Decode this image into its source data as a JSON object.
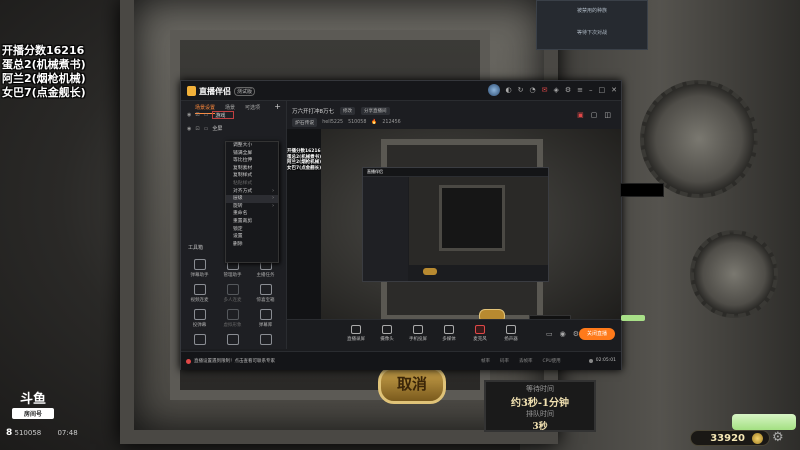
{
  "overlay_text": {
    "line1": "开播分数16216",
    "line2": "蛋总2(机械煮书)",
    "line3": "阿兰2(烟枪机械)",
    "line4": "女巴7(点金舰长)"
  },
  "top_right_menu": {
    "item1": "被禁用的种族",
    "item2": "等待下次对战"
  },
  "game": {
    "cancel_label": "取消",
    "wait_title": "等待时间",
    "wait_value": "约3秒-1分钟",
    "queue_title": "排队时间",
    "queue_value": "3秒",
    "gold": "33920",
    "logo": "斗鱼",
    "room_label": "房间号",
    "viewers": "8",
    "room_number": "510058",
    "time": "07:48"
  },
  "app": {
    "name": "直播伴侣",
    "badge": "测试版",
    "tabs": [
      "场景设置",
      "场景",
      "可选项"
    ],
    "add_label": "+",
    "scene_main": "游戏",
    "scene_label": "全屏",
    "context_menu": [
      {
        "label": "调整大小",
        "arrow": "",
        "state": "normal"
      },
      {
        "label": "铺满全屏",
        "arrow": "",
        "state": "normal"
      },
      {
        "label": "等比拉伸",
        "arrow": "",
        "state": "normal"
      },
      {
        "label": "复制素材",
        "arrow": "",
        "state": "normal"
      },
      {
        "label": "复制样式",
        "arrow": "",
        "state": "normal"
      },
      {
        "label": "粘贴样式",
        "arrow": "",
        "state": "dim"
      },
      {
        "label": "对齐方式",
        "arrow": "›",
        "state": "normal"
      },
      {
        "label": "层级",
        "arrow": "›",
        "state": "sel"
      },
      {
        "label": "旋转",
        "arrow": "›",
        "state": "normal"
      },
      {
        "label": "重命名",
        "arrow": "",
        "state": "normal"
      },
      {
        "label": "重置裁剪",
        "arrow": "",
        "state": "normal"
      },
      {
        "label": "锁定",
        "arrow": "",
        "state": "normal"
      },
      {
        "label": "设置",
        "arrow": "",
        "state": "normal"
      },
      {
        "label": "删除",
        "arrow": "",
        "state": "normal"
      }
    ],
    "tools_label": "工具箱",
    "tools": [
      {
        "label": "弹幕助手",
        "state": "normal"
      },
      {
        "label": "管理助手",
        "state": "normal"
      },
      {
        "label": "主播任务",
        "state": "normal"
      },
      {
        "label": "视频连麦",
        "state": "normal"
      },
      {
        "label": "多人连麦",
        "state": "dim"
      },
      {
        "label": "惊喜宝箱",
        "state": "normal"
      },
      {
        "label": "投弹幕",
        "state": "normal"
      },
      {
        "label": "虚拟形象",
        "state": "dim"
      },
      {
        "label": "弹幕库",
        "state": "normal"
      },
      {
        "label": "",
        "state": "normal"
      },
      {
        "label": "",
        "state": "normal"
      },
      {
        "label": "",
        "state": "normal"
      }
    ],
    "stream_title": "万六开打冲8万七",
    "edit_label": "修改",
    "category": "炉石传说",
    "share_label": "分享直播间",
    "follow_label": "hell5225",
    "room_id": "510058",
    "hot": "212456",
    "controls": [
      "直播录屏",
      "摄像头",
      "手机投屏",
      "多媒体",
      "麦克风",
      "扬声器"
    ],
    "live_button": "关闭直播",
    "status_warn": "直播设置遇到限制！点击查看可联系专家",
    "status_stats": [
      "帧率",
      "码率",
      "丢帧率",
      "CPU使用"
    ],
    "timer": "02:05:01"
  }
}
